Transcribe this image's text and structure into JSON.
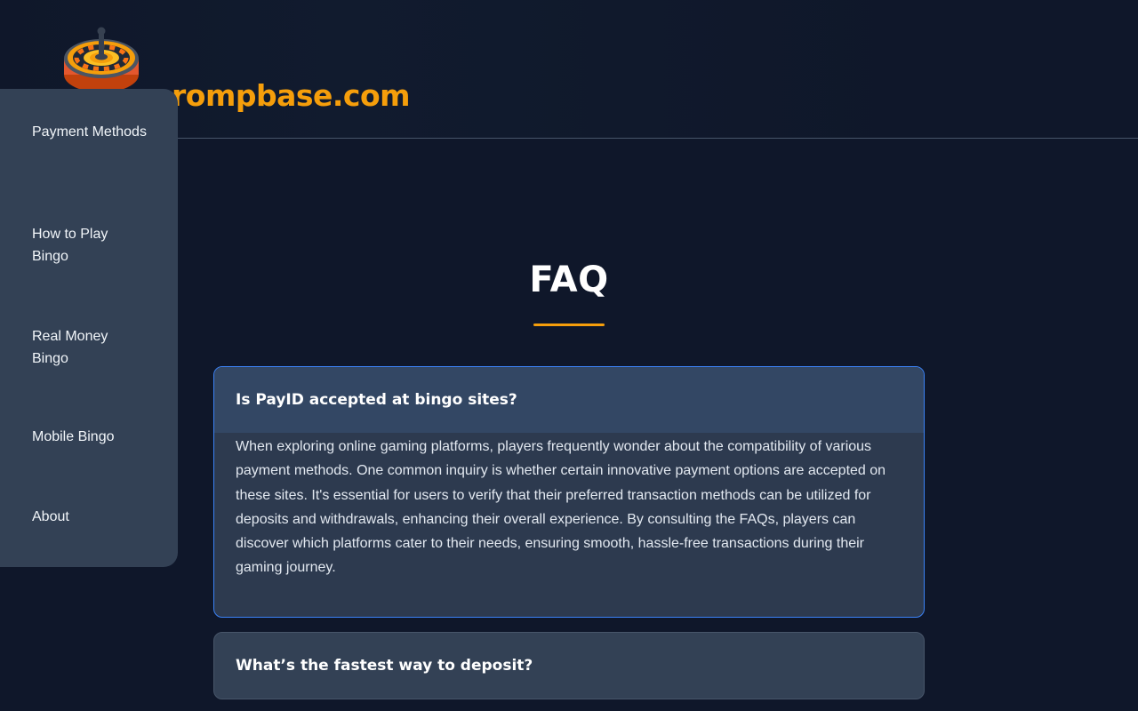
{
  "header": {
    "brand": "rompbase.com",
    "logo_icon": "roulette-wheel-icon"
  },
  "sidebar": {
    "items": [
      {
        "label": "Payment Methods"
      },
      {
        "label": "How to Play Bingo"
      },
      {
        "label": "Real Money Bingo"
      },
      {
        "label": "Mobile Bingo"
      },
      {
        "label": "About"
      }
    ]
  },
  "faq": {
    "title": "FAQ",
    "items": [
      {
        "question": "Is PayID accepted at bingo sites?",
        "answer": "When exploring online gaming platforms, players frequently wonder about the compatibility of various payment methods. One common inquiry is whether certain innovative payment options are accepted on these sites. It's essential for users to verify that their preferred transaction methods can be utilized for deposits and withdrawals, enhancing their overall experience. By consulting the FAQs, players can discover which platforms cater to their needs, ensuring smooth, hassle-free transactions during their gaming journey.",
        "expanded": true
      },
      {
        "question": "What’s the fastest way to deposit?",
        "expanded": false
      }
    ]
  },
  "colors": {
    "background": "#0f172a",
    "accent": "#f59e0b",
    "panel": "#334155",
    "active_border": "#3b82f6"
  }
}
